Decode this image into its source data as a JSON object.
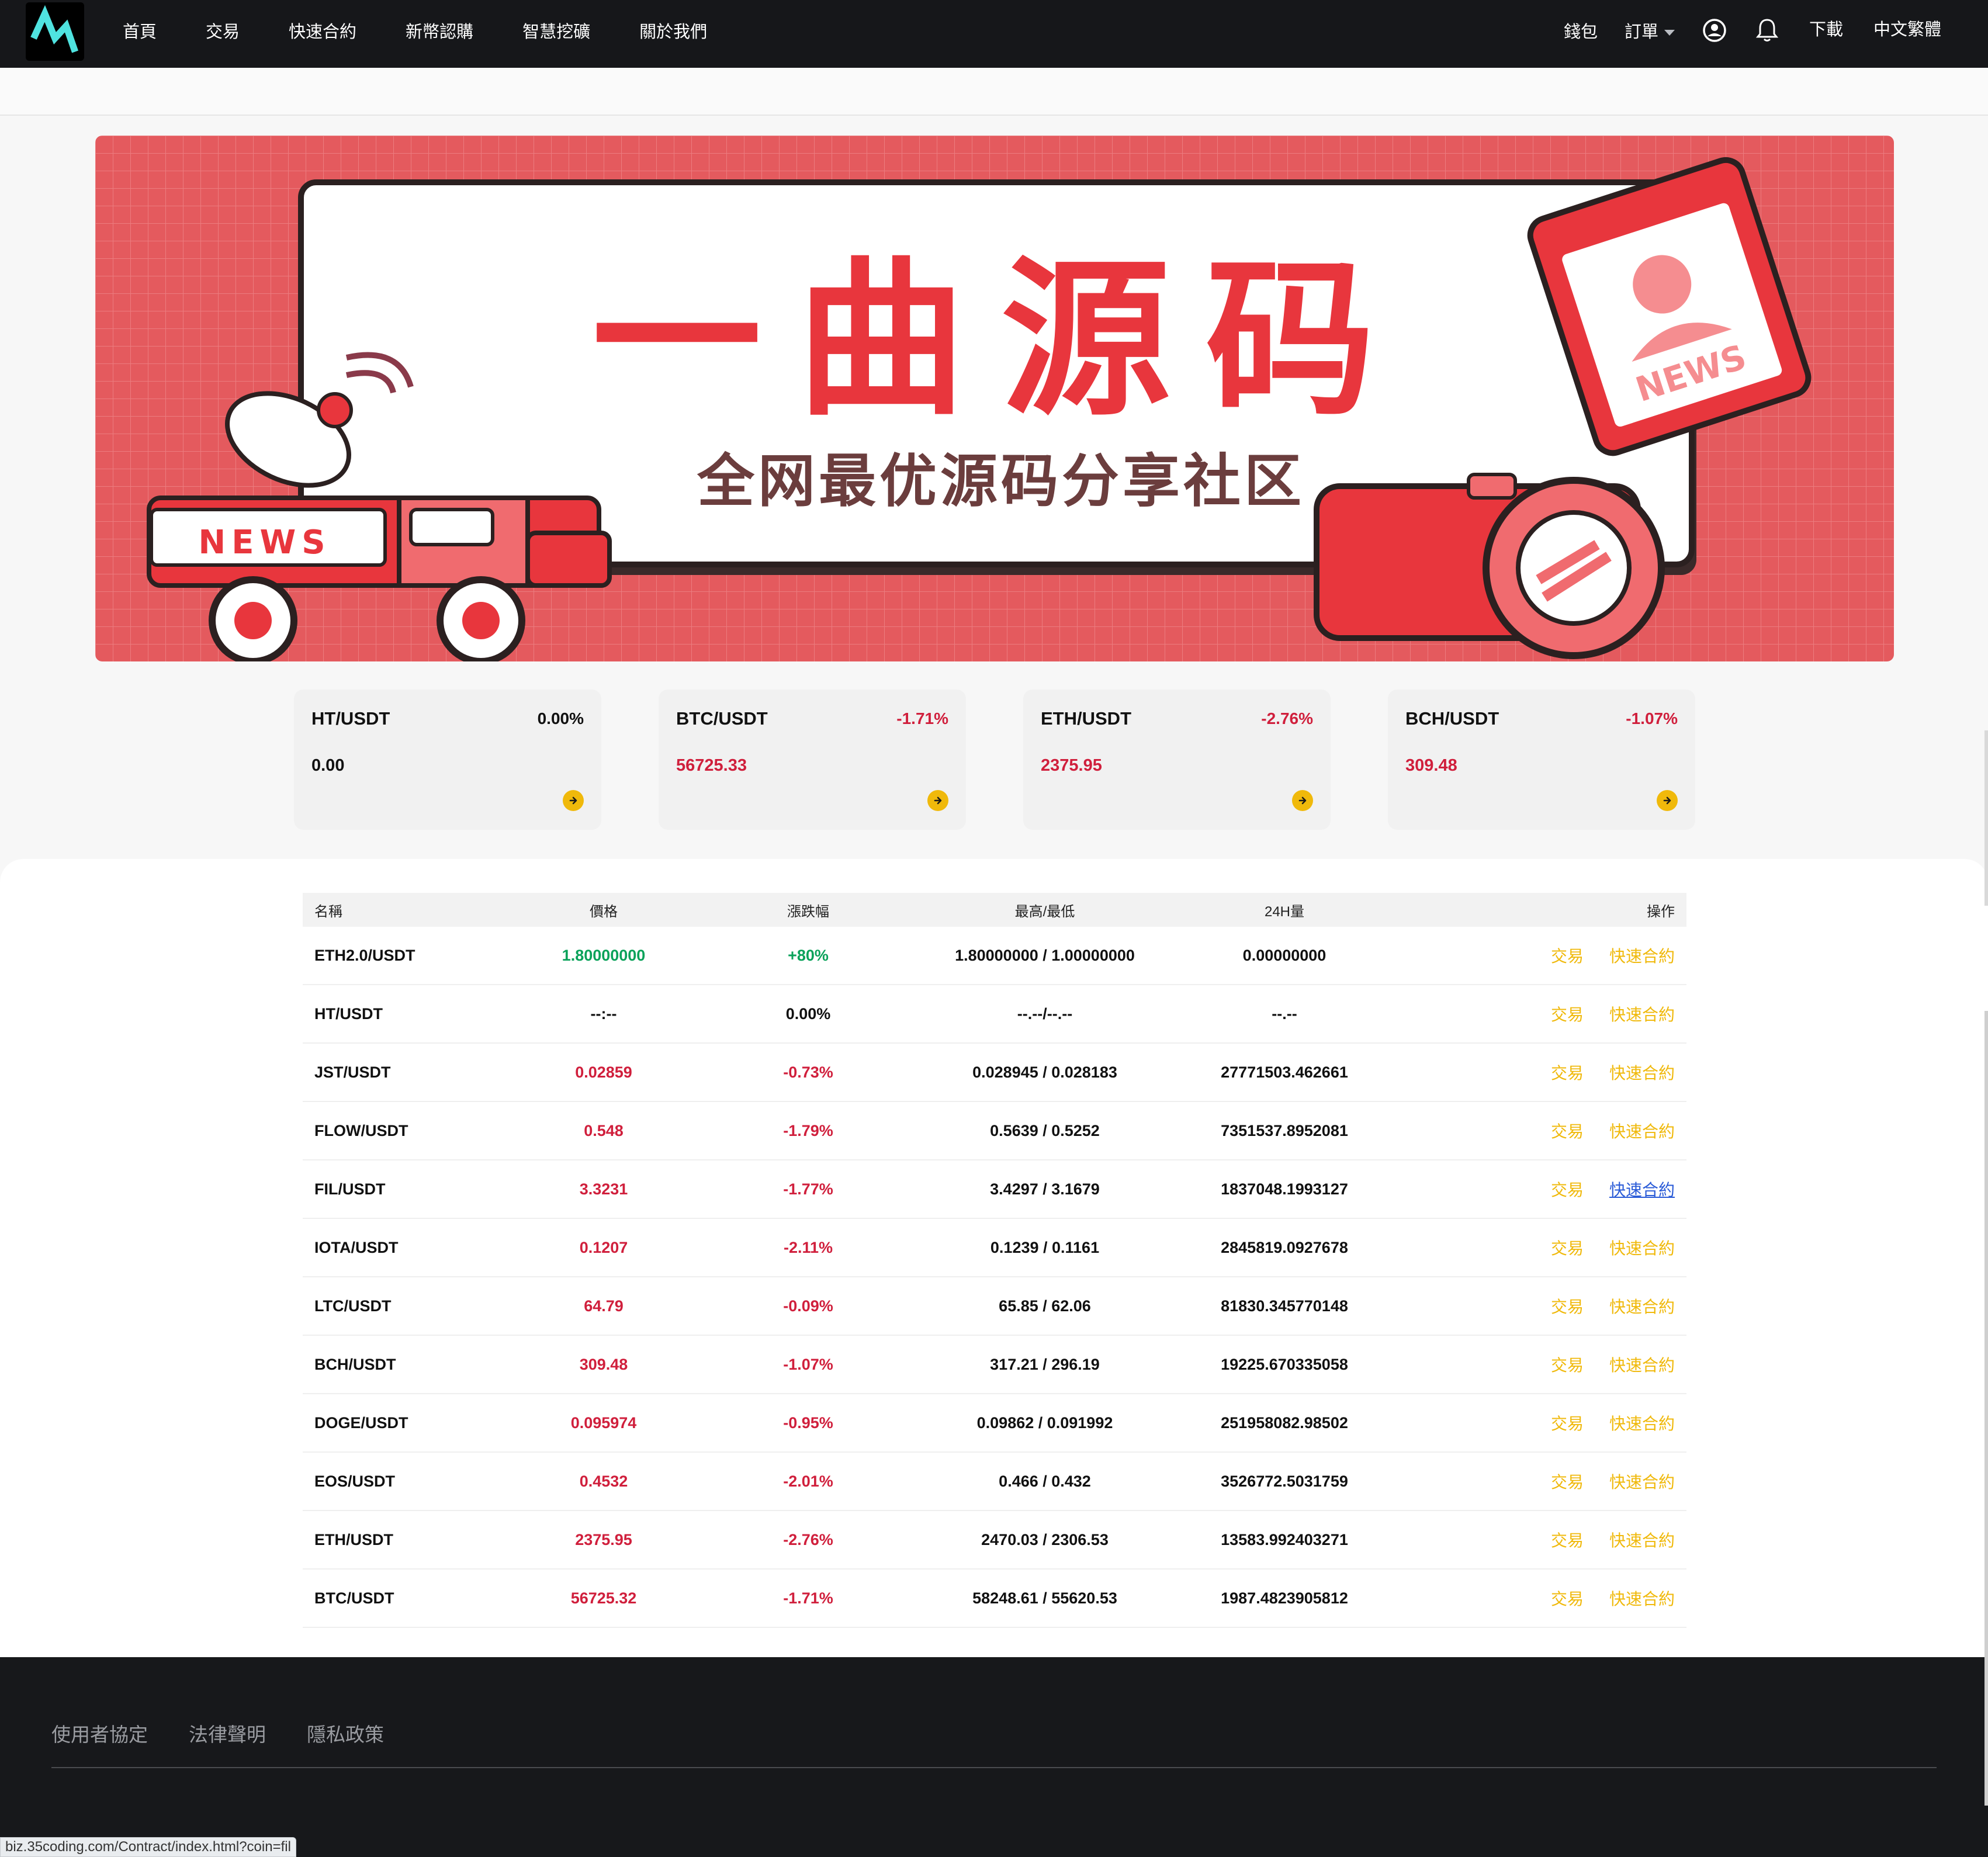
{
  "nav": {
    "left": [
      "首頁",
      "交易",
      "快速合約",
      "新幣認購",
      "智慧挖礦",
      "關於我們"
    ],
    "wallet": "錢包",
    "orders": "訂單",
    "download": "下載",
    "language": "中文繁體"
  },
  "banner": {
    "title": "一曲源码",
    "subtitle": "全网最优源码分享社区",
    "truck_label": "NEWS",
    "badge_label": "NEWS"
  },
  "tickers": [
    {
      "pair": "HT/USDT",
      "change": "0.00%",
      "price": "0.00",
      "trend": "flat"
    },
    {
      "pair": "BTC/USDT",
      "change": "-1.71%",
      "price": "56725.33",
      "trend": "down"
    },
    {
      "pair": "ETH/USDT",
      "change": "-2.76%",
      "price": "2375.95",
      "trend": "down"
    },
    {
      "pair": "BCH/USDT",
      "change": "-1.07%",
      "price": "309.48",
      "trend": "down"
    }
  ],
  "table": {
    "headers": {
      "name": "名稱",
      "price": "價格",
      "change": "漲跌幅",
      "high_low": "最高/最低",
      "volume": "24H量",
      "op": "操作"
    },
    "trade_label": "交易",
    "contract_label": "快速合約",
    "rows": [
      {
        "name": "ETH2.0/USDT",
        "price": "1.80000000",
        "change": "+80%",
        "high_low": "1.80000000 / 1.00000000",
        "volume": "0.00000000",
        "trend": "up"
      },
      {
        "name": "HT/USDT",
        "price": "--:--",
        "change": "0.00%",
        "high_low": "--.--/--.--",
        "volume": "--.--",
        "trend": "flat"
      },
      {
        "name": "JST/USDT",
        "price": "0.02859",
        "change": "-0.73%",
        "high_low": "0.028945 / 0.028183",
        "volume": "27771503.462661",
        "trend": "down"
      },
      {
        "name": "FLOW/USDT",
        "price": "0.548",
        "change": "-1.79%",
        "high_low": "0.5639 / 0.5252",
        "volume": "7351537.8952081",
        "trend": "down"
      },
      {
        "name": "FIL/USDT",
        "price": "3.3231",
        "change": "-1.77%",
        "high_low": "3.4297 / 3.1679",
        "volume": "1837048.1993127",
        "trend": "down",
        "hover": true
      },
      {
        "name": "IOTA/USDT",
        "price": "0.1207",
        "change": "-2.11%",
        "high_low": "0.1239 / 0.1161",
        "volume": "2845819.0927678",
        "trend": "down"
      },
      {
        "name": "LTC/USDT",
        "price": "64.79",
        "change": "-0.09%",
        "high_low": "65.85 / 62.06",
        "volume": "81830.345770148",
        "trend": "down"
      },
      {
        "name": "BCH/USDT",
        "price": "309.48",
        "change": "-1.07%",
        "high_low": "317.21 / 296.19",
        "volume": "19225.670335058",
        "trend": "down"
      },
      {
        "name": "DOGE/USDT",
        "price": "0.095974",
        "change": "-0.95%",
        "high_low": "0.09862 / 0.091992",
        "volume": "251958082.98502",
        "trend": "down"
      },
      {
        "name": "EOS/USDT",
        "price": "0.4532",
        "change": "-2.01%",
        "high_low": "0.466 / 0.432",
        "volume": "3526772.5031759",
        "trend": "down"
      },
      {
        "name": "ETH/USDT",
        "price": "2375.95",
        "change": "-2.76%",
        "high_low": "2470.03 / 2306.53",
        "volume": "13583.992403271",
        "trend": "down"
      },
      {
        "name": "BTC/USDT",
        "price": "56725.32",
        "change": "-1.71%",
        "high_low": "58248.61 / 55620.53",
        "volume": "1987.4823905812",
        "trend": "down"
      }
    ]
  },
  "footer": {
    "links": [
      "使用者協定",
      "法律聲明",
      "隱私政策"
    ]
  },
  "status_url": "biz.35coding.com/Contract/index.html?coin=fil",
  "colors": {
    "accent": "#f0b90b",
    "down": "#d01f3c",
    "up": "#0aa25a",
    "nav_bg": "#16171a",
    "banner_bg": "#e45a5e"
  }
}
